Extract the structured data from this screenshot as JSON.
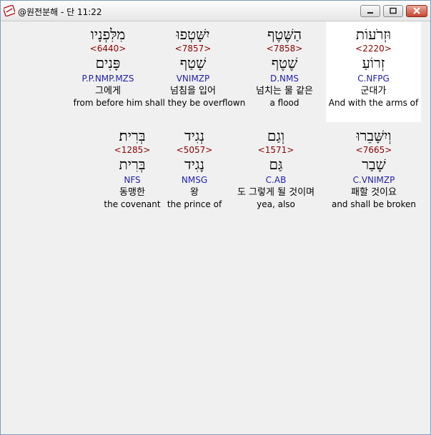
{
  "window": {
    "title": "@원전분해 - 단 11:22",
    "icon": "bible-book-icon"
  },
  "rows": [
    [
      {
        "hebrew": "מִלִּפְנָיו",
        "strongs": "<6440>",
        "lemma": "פָּנִים",
        "parse": "P.P.NMP.MZS",
        "korean": "그에게",
        "english": "from before him"
      },
      {
        "hebrew": "יִשָּׁטְפוּ",
        "strongs": "<7857>",
        "lemma": "שָׁטַף",
        "parse": "VNIMZP",
        "korean": "넘침을 입어",
        "english": "shall they be overflown"
      },
      {
        "hebrew": "הַשֶּׁטֶף",
        "strongs": "<7858>",
        "lemma": "שֶׁטֶף",
        "parse": "D.NMS",
        "korean": "넘치는 물 같은",
        "english": "a flood"
      },
      {
        "hebrew": "וּזְרֹעוֹת",
        "strongs": "<2220>",
        "lemma": "זְרוֹעַ",
        "parse": "C.NFPG",
        "korean": "군대가",
        "english": "And with the arms of",
        "selected": true
      }
    ],
    [
      {
        "hebrew": "בְּרִית׃",
        "strongs": "<1285>",
        "lemma": "בְּרִית",
        "parse": "NFS",
        "korean": "동맹한",
        "english": "the covenant"
      },
      {
        "hebrew": "נְגִיד",
        "strongs": "<5057>",
        "lemma": "נָגִיד",
        "parse": "NMSG",
        "korean": "왕",
        "english": "the prince of"
      },
      {
        "hebrew": "וְגַם",
        "strongs": "<1571>",
        "lemma": "גַּם",
        "parse": "C.AB",
        "korean": "도 그렇게 될 것이며",
        "english": "yea, also"
      },
      {
        "hebrew": "וְיִשָּׁבֵרוּ",
        "strongs": "<7665>",
        "lemma": "שָׁבַר",
        "parse": "C.VNIMZP",
        "korean": "패할 것이요",
        "english": "and shall be broken"
      }
    ]
  ],
  "colors": {
    "strongs": "#8b0000",
    "parse": "#1f1fa8",
    "selected_bg": "#ffffff",
    "background": "#f0f0f0"
  }
}
